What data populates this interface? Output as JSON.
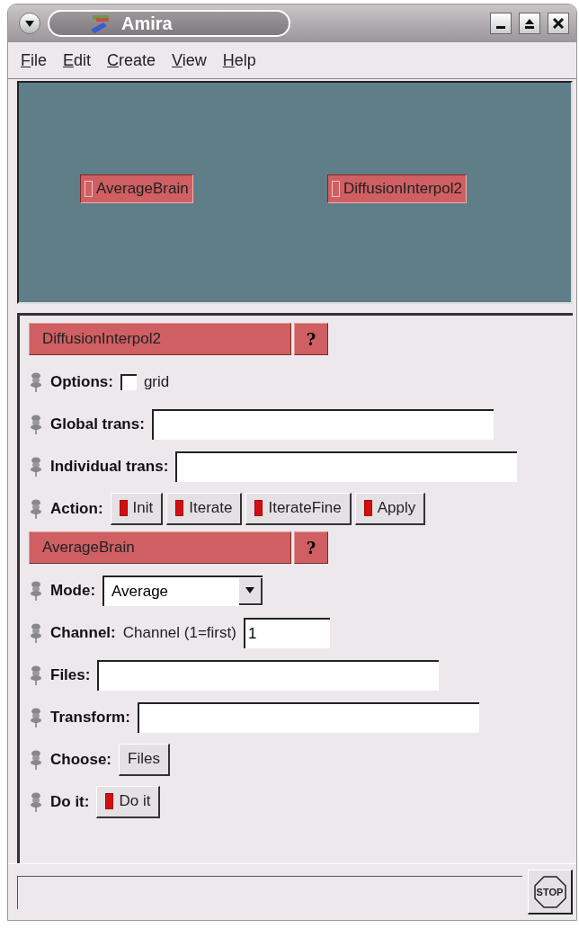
{
  "window": {
    "title": "Amira"
  },
  "menu": [
    "File",
    "Edit",
    "Create",
    "View",
    "Help"
  ],
  "canvas_nodes": [
    {
      "label": "AverageBrain"
    },
    {
      "label": "DiffusionInterpol2"
    }
  ],
  "modules": [
    {
      "title": "DiffusionInterpol2",
      "help": "?",
      "rows": [
        {
          "kind": "toggle",
          "label": "Options:",
          "option": "grid",
          "checked": false
        },
        {
          "kind": "field",
          "label": "Global trans:"
        },
        {
          "kind": "field",
          "label": "Individual trans:"
        },
        {
          "kind": "buttons",
          "label": "Action:",
          "buttons": [
            {
              "text": "Init",
              "led": true
            },
            {
              "text": "Iterate",
              "led": true
            },
            {
              "text": "IterateFine",
              "led": true
            },
            {
              "text": "Apply",
              "led": true
            }
          ]
        }
      ]
    },
    {
      "title": "AverageBrain",
      "help": "?",
      "rows": [
        {
          "kind": "select",
          "label": "Mode:",
          "value": "Average"
        },
        {
          "kind": "field",
          "label": "Channel:",
          "caption": "Channel (1=first)",
          "value": "1"
        },
        {
          "kind": "field",
          "label": "Files:"
        },
        {
          "kind": "field",
          "label": "Transform:"
        },
        {
          "kind": "buttons",
          "label": "Choose:",
          "buttons": [
            {
              "text": "Files",
              "led": false
            }
          ]
        },
        {
          "kind": "buttons",
          "label": "Do it:",
          "buttons": [
            {
              "text": "Do it",
              "led": true
            }
          ]
        }
      ]
    }
  ],
  "stop_button": "STOP"
}
